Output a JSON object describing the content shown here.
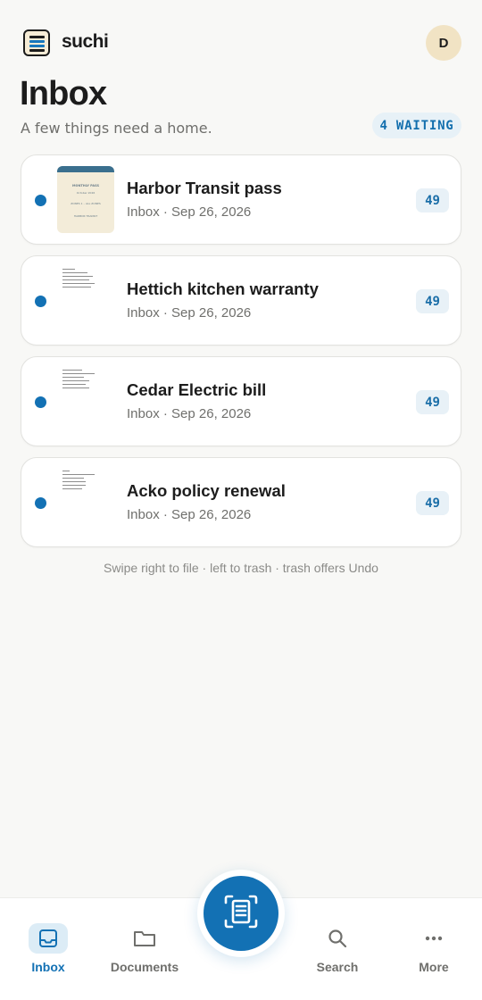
{
  "app": {
    "name": "suchi",
    "avatar_initial": "D"
  },
  "header": {
    "title": "Inbox",
    "subtitle": "A few things need a home.",
    "waiting_badge": "4 WAITING"
  },
  "items": [
    {
      "title": "Harbor Transit pass",
      "meta": "Inbox · Sep 26, 2026",
      "count": "49",
      "unread": true,
      "thumb": {
        "kind": "pass",
        "lines": [
          "MONTHLY PASS",
          "October 2026",
          "ZONES 1 – ALL ZONES",
          "HARBOR TRANSIT"
        ]
      }
    },
    {
      "title": "Hettich kitchen warranty",
      "meta": "Inbox · Sep 26, 2026",
      "count": "49",
      "unread": true,
      "thumb": {
        "kind": "document"
      }
    },
    {
      "title": "Cedar Electric bill",
      "meta": "Inbox · Sep 26, 2026",
      "count": "49",
      "unread": true,
      "thumb": {
        "kind": "document"
      }
    },
    {
      "title": "Acko policy renewal",
      "meta": "Inbox · Sep 26, 2026",
      "count": "49",
      "unread": true,
      "thumb": {
        "kind": "document"
      }
    }
  ],
  "hint": "Swipe right to file · left to trash · trash offers Undo",
  "nav": {
    "inbox": "Inbox",
    "documents": "Documents",
    "search": "Search",
    "more": "More"
  },
  "colors": {
    "accent": "#1371b4",
    "badge_bg": "#e7f1f7",
    "background": "#f8f8f6"
  },
  "icons": {
    "logo": "list-document-icon",
    "inbox": "inbox-tray-icon",
    "documents": "folder-icon",
    "scan": "scan-document-icon",
    "search": "search-icon",
    "more": "more-dots-icon"
  }
}
